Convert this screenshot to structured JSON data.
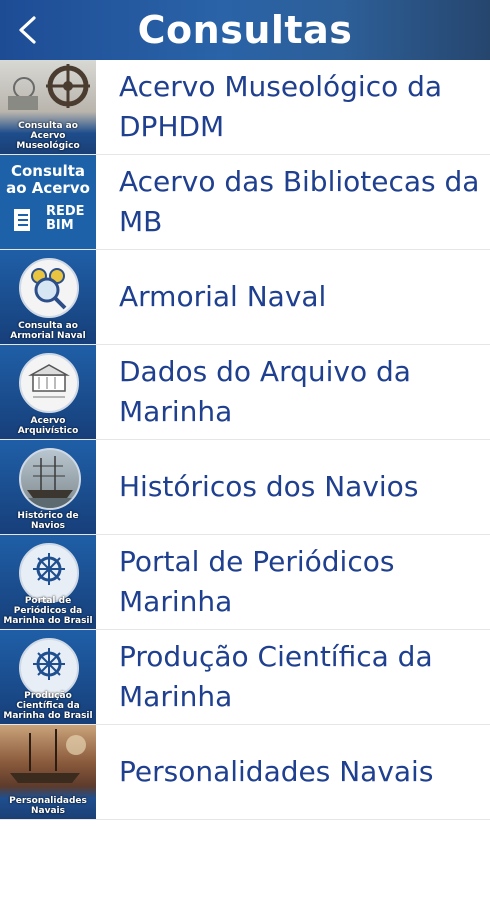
{
  "header": {
    "title": "Consultas",
    "back_icon": "chevron-left-icon"
  },
  "items": [
    {
      "label": "Acervo Museológico da DPHDM",
      "thumb_caption": "Consulta ao Acervo Museológico"
    },
    {
      "label": "Acervo das Bibliotecas da MB",
      "thumb_title": "Consulta ao Acervo",
      "thumb_caption": "REDE BIM"
    },
    {
      "label": "Armorial Naval",
      "thumb_caption": "Consulta ao Armorial Naval"
    },
    {
      "label": "Dados  do Arquivo da Marinha",
      "thumb_caption": "Acervo Arquivístico"
    },
    {
      "label": "Históricos dos Navios",
      "thumb_caption": "Histórico de Navios"
    },
    {
      "label": "Portal de Periódicos Marinha",
      "thumb_caption": "Portal de Periódicos da Marinha do Brasil"
    },
    {
      "label": "Produção Científica da Marinha",
      "thumb_caption": "Produção Científica da Marinha do Brasil"
    },
    {
      "label": "Personalidades Navais",
      "thumb_caption": "Personalidades Navais"
    }
  ],
  "colors": {
    "header": "#2a63a8",
    "item_text": "#1f3f8f",
    "thumb_blue": "#1f5fa7"
  }
}
